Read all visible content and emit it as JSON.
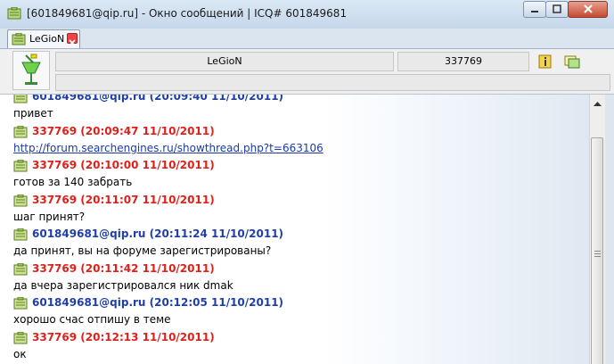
{
  "window": {
    "title": "[601849681@qip.ru] - Окно сообщений | ICQ# 601849681"
  },
  "tab": {
    "label": "LeGioN"
  },
  "contact": {
    "name": "LeGioN",
    "uin": "337769",
    "status": ""
  },
  "messages": [
    {
      "sender": "me",
      "header": "601849681@qip.ru (20:09:40 11/10/2011)",
      "text": "привет",
      "is_link": false
    },
    {
      "sender": "them",
      "header": "337769 (20:09:47 11/10/2011)",
      "text": "http://forum.searchengines.ru/showthread.php?t=663106",
      "is_link": true
    },
    {
      "sender": "them",
      "header": "337769 (20:10:00 11/10/2011)",
      "text": "готов за 140 забрать",
      "is_link": false
    },
    {
      "sender": "them",
      "header": "337769 (20:11:07 11/10/2011)",
      "text": "шаг принят?",
      "is_link": false
    },
    {
      "sender": "me",
      "header": "601849681@qip.ru (20:11:24 11/10/2011)",
      "text": "да принят, вы на форуме зарегистрированы?",
      "is_link": false
    },
    {
      "sender": "them",
      "header": "337769 (20:11:42 11/10/2011)",
      "text": "да вчера зарегистрировался ник dmak",
      "is_link": false
    },
    {
      "sender": "me",
      "header": "601849681@qip.ru (20:12:05 11/10/2011)",
      "text": "хорошо счас отпишу в теме",
      "is_link": false
    },
    {
      "sender": "them",
      "header": "337769 (20:12:13 11/10/2011)",
      "text": "ок",
      "is_link": false
    }
  ],
  "icons": {
    "title": "qip-window-icon",
    "tab": "contact-icon",
    "tab_close": "close-icon",
    "avatar": "cocktail-icon",
    "info": "info-icon",
    "history": "history-icon",
    "message": "message-note-icon"
  },
  "colors": {
    "me": "#1f3fa8",
    "them": "#e0201b",
    "link": "#1a3aa8"
  }
}
